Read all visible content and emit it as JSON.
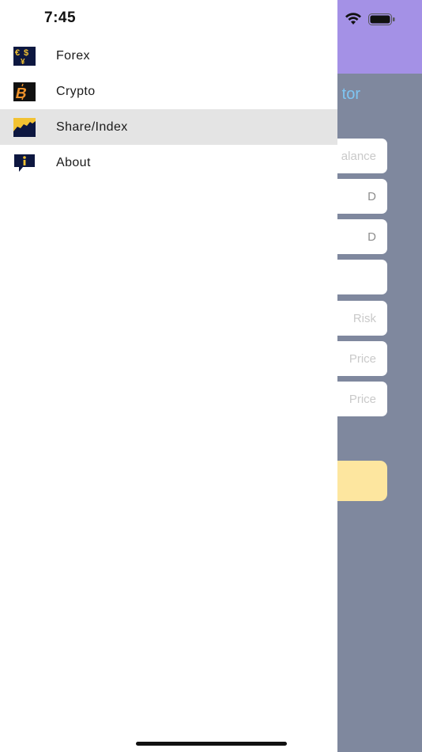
{
  "status_bar": {
    "time": "7:45"
  },
  "drawer": {
    "items": [
      {
        "label": "Forex",
        "icon": "forex-icon",
        "active": false
      },
      {
        "label": "Crypto",
        "icon": "bitcoin-icon",
        "active": false
      },
      {
        "label": "Share/Index",
        "icon": "chart-icon",
        "active": true
      },
      {
        "label": "About",
        "icon": "info-icon",
        "active": false
      }
    ]
  },
  "app": {
    "title_fragment": "tor",
    "fields": [
      {
        "placeholder": "alance"
      },
      {
        "value": "D"
      },
      {
        "value": "D"
      },
      {
        "value": ""
      },
      {
        "placeholder": "Risk"
      },
      {
        "placeholder": "Price"
      },
      {
        "placeholder": "Price"
      }
    ]
  },
  "colors": {
    "header": "#a491e6",
    "body": "#7f889e",
    "accent_text": "#7ec6f3",
    "button": "#fde69f",
    "active_row": "#e4e4e4"
  }
}
